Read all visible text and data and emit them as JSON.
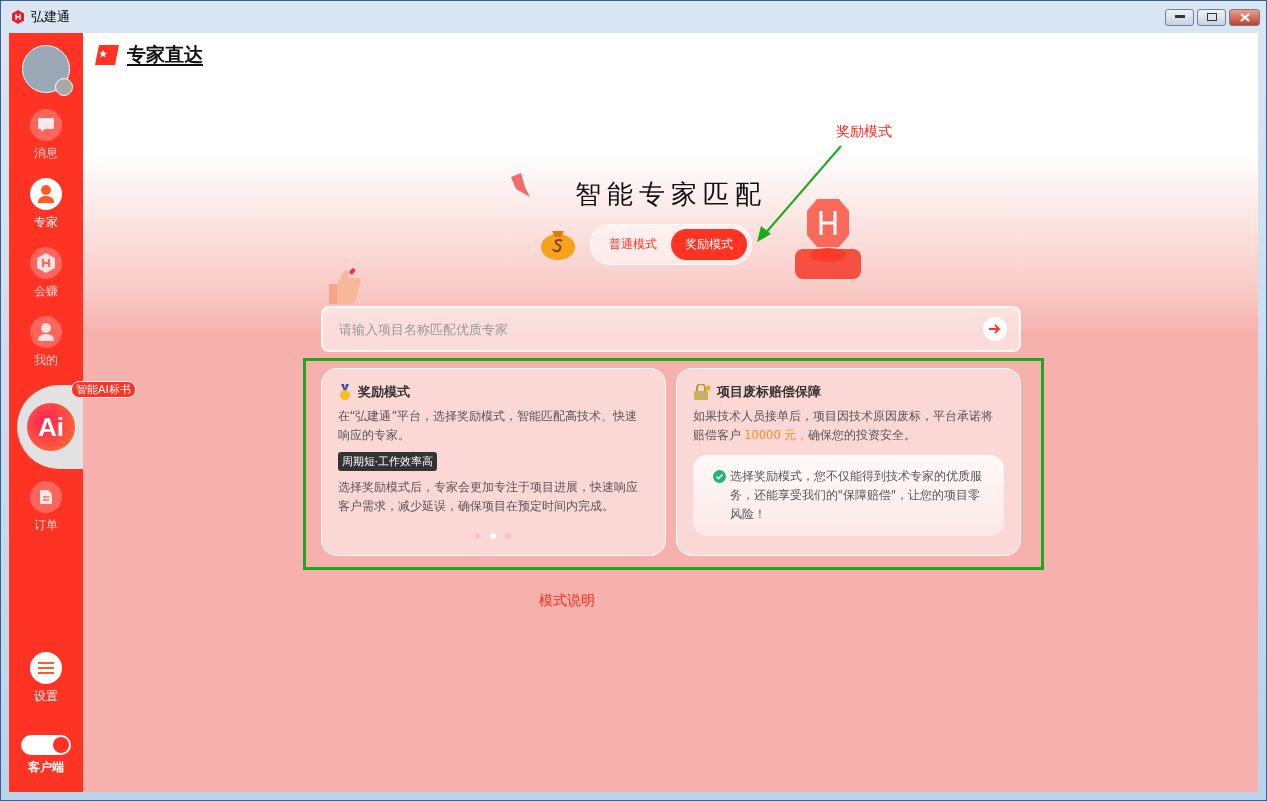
{
  "window": {
    "title": "弘建通"
  },
  "sidebar": {
    "items": [
      {
        "label": "消息",
        "kind": "chat",
        "selected": false
      },
      {
        "label": "专家",
        "kind": "worker",
        "selected": true
      },
      {
        "label": "会赚",
        "kind": "badge",
        "selected": false
      },
      {
        "label": "我的",
        "kind": "person",
        "selected": false
      },
      {
        "label": "Ai",
        "kind": "ai",
        "badge": "智能AI标书",
        "selected": false
      },
      {
        "label": "订单",
        "kind": "doc",
        "selected": false
      }
    ],
    "settings": {
      "label": "设置"
    },
    "client_switch": {
      "label": "客户端",
      "on": true
    }
  },
  "header": {
    "logo_text": "专家直达"
  },
  "main": {
    "title": "智能专家匹配",
    "modes": [
      {
        "label": "普通模式",
        "selected": false
      },
      {
        "label": "奖励模式",
        "selected": true
      }
    ],
    "search": {
      "placeholder": "请输入项目名称匹配优质专家"
    },
    "cards": [
      {
        "kind": "reward",
        "title": "奖励模式",
        "intro": "在“弘建通”平台，选择奖励模式，智能匹配高技术、快速响应的专家。",
        "tag": "周期短·工作效率高",
        "body": "选择奖励模式后，专家会更加专注于项目进展，快速响应客户需求，减少延误，确保项目在预定时间内完成。",
        "dots": [
          {
            "selected": false
          },
          {
            "selected": true
          },
          {
            "selected": false
          }
        ]
      },
      {
        "kind": "guarantee",
        "title": "项目废标赔偿保障",
        "text_before": "如果技术人员接单后，项目因技术原因废标，平台承诺将赔偿客户 ",
        "highlight": "10000 元，",
        "text_after": "确保您的投资安全。",
        "note": "选择奖励模式，您不仅能得到技术专家的优质服务，还能享受我们的\"保障赔偿\"，让您的项目零风险！"
      }
    ]
  },
  "annotations": [
    {
      "kind": "arrow",
      "label": "奖励模式"
    },
    {
      "kind": "box",
      "label": "模式说明"
    }
  ]
}
